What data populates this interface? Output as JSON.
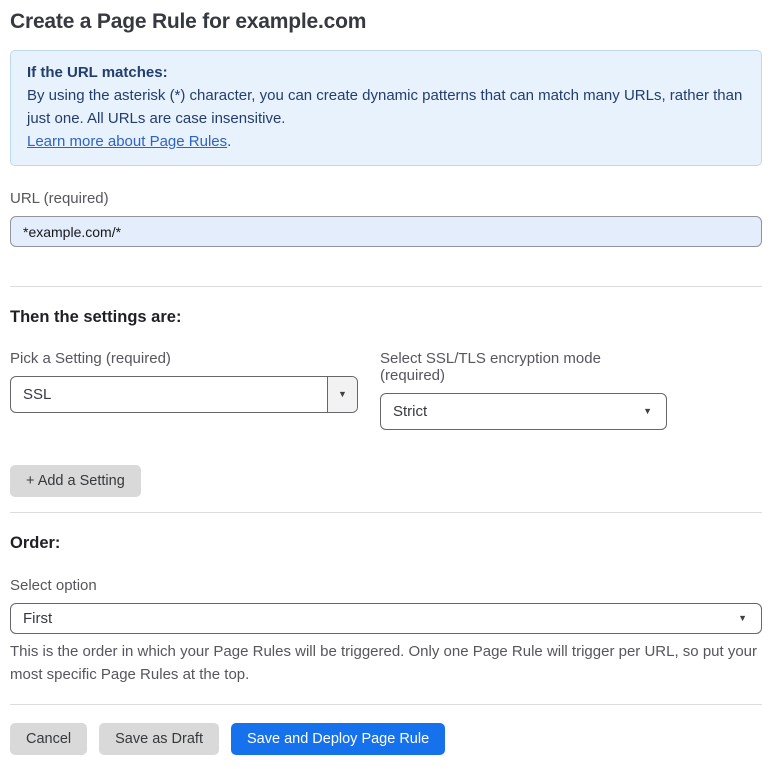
{
  "page": {
    "title": "Create a Page Rule for example.com"
  },
  "info_box": {
    "heading": "If the URL matches:",
    "body": "By using the asterisk (*) character, you can create dynamic patterns that can match many URLs, rather than just one. All URLs are case insensitive.",
    "link_label": "Learn more about Page Rules",
    "link_suffix": "."
  },
  "url_field": {
    "label": "URL (required)",
    "value": "*example.com/*"
  },
  "settings_section": {
    "heading": "Then the settings are:",
    "setting_picker": {
      "label": "Pick a Setting (required)",
      "value": "SSL"
    },
    "mode_picker": {
      "label": "Select SSL/TLS encryption mode (required)",
      "value": "Strict"
    },
    "add_setting_label": "+ Add a Setting"
  },
  "order_section": {
    "heading": "Order:",
    "select_label": "Select option",
    "value": "First",
    "help_text": "This is the order in which your Page Rules will be triggered. Only one Page Rule will trigger per URL, so put your most specific Page Rules at the top."
  },
  "footer": {
    "cancel_label": "Cancel",
    "save_draft_label": "Save as Draft",
    "save_deploy_label": "Save and Deploy Page Rule"
  },
  "colors": {
    "accent_blue": "#1672EC",
    "info_box_bg": "#E8F2FC",
    "info_box_border": "#BDD9F2",
    "info_box_text": "#223D6F",
    "link_blue": "#2D63C8",
    "url_input_bg": "#E3EDFB",
    "gray_button_bg": "#D9D9D9"
  },
  "icons": {
    "dropdown_caret": "▼"
  }
}
